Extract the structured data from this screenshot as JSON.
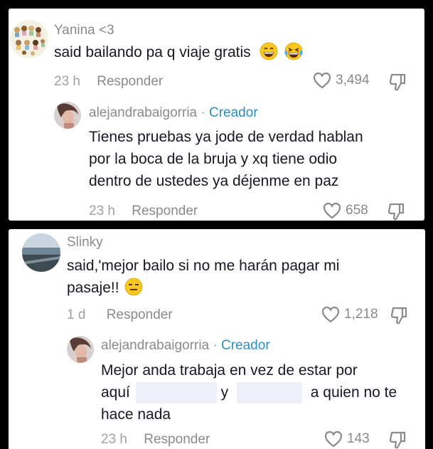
{
  "card1": {
    "comment": {
      "username": "Yanina <3",
      "text": "said bailando pa q viaje gratis",
      "time": "23 h",
      "reply_label": "Responder",
      "likes": "3,494"
    },
    "reply": {
      "username": "alejandrabaigorria",
      "separator": "·",
      "creator_label": "Creador",
      "lines": [
        "Tienes pruebas ya jode de verdad hablan",
        "por la boca de la bruja y xq tiene odio",
        "dentro de ustedes ya déjenme en paz"
      ],
      "time": "23 h",
      "reply_label": "Responder",
      "likes": "658"
    }
  },
  "card2": {
    "comment": {
      "username": "Slinky",
      "line1": "said,'mejor bailo si no me harán pagar mi",
      "line2": "pasaje!!",
      "time": "1 d",
      "reply_label": "Responder",
      "likes": "1,218"
    },
    "reply": {
      "username": "alejandrabaigorria",
      "separator": "·",
      "creator_label": "Creador",
      "line1": "Mejor anda trabaja en vez de estar por",
      "line2_a": "aquí",
      "line2_b": "y",
      "line2_c": "a quien no te",
      "line3": "hace nada",
      "time": "23 h",
      "reply_label": "Responder",
      "likes": "143"
    }
  },
  "icons": {
    "like": "heart-outline-icon",
    "dislike": "thumbs-down-icon",
    "emoji_grin": "grinning-face-emoji",
    "emoji_laugh_cry": "laughing-tears-emoji",
    "emoji_unamused": "expressionless-face-emoji"
  },
  "colors": {
    "creator": "#2a8fbf",
    "secondary_text": "#8a8a8a",
    "primary_text": "#161823",
    "redaction": "#eceff8"
  }
}
